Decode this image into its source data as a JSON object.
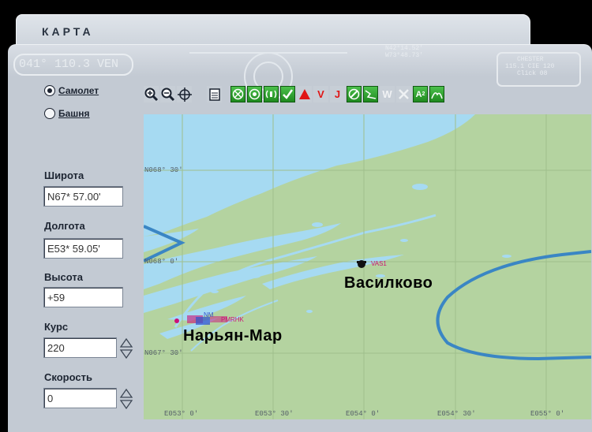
{
  "window": {
    "title": "КАРТА"
  },
  "background_text": {
    "left_freq": "041° 110.3 VEN",
    "right_box_1": "CHESTER",
    "right_box_2": "115.1 CIE 120",
    "right_box_3": "Click 08",
    "coords_1": "N42°14.52'",
    "coords_2": "W73°48.73'"
  },
  "mode": {
    "airplane_label": "Самолет",
    "tower_label": "Башня",
    "selected": "airplane"
  },
  "fields": {
    "latitude_label": "Широта",
    "latitude_value": "N67* 57.00'",
    "longitude_label": "Долгота",
    "longitude_value": "E53* 59.05'",
    "altitude_label": "Высота",
    "altitude_value": "+59",
    "heading_label": "Курс",
    "heading_value": "220",
    "speed_label": "Скорость",
    "speed_value": "0"
  },
  "toolbar": {
    "icons": [
      "zoom-in-icon",
      "zoom-out-icon",
      "center-icon",
      "print-icon",
      "vor-icon",
      "ndb-icon",
      "ils-icon",
      "check-icon",
      "triangle-icon",
      "v-icon",
      "j-icon",
      "airport-icon",
      "route-icon",
      "w-icon",
      "x-icon",
      "a-icon",
      "terrain-icon"
    ],
    "letters": {
      "v": "V",
      "j": "J",
      "w": "W",
      "a": "A"
    }
  },
  "map": {
    "cities": [
      {
        "name": "Василково",
        "code": "VAS1"
      },
      {
        "name": "Нарьян-Мар",
        "code": "NM"
      }
    ],
    "nm_label_extra": "PMRHK",
    "lat_labels": [
      "N068° 30'",
      "N068° 0'",
      "N067° 30'"
    ],
    "lon_labels": [
      "E053° 0'",
      "E053° 30'",
      "E054° 0'",
      "E054° 30'",
      "E055° 0'"
    ],
    "colors": {
      "land": "#b4d3a0",
      "water": "#a6daf2",
      "airspace": "#3a86c4"
    }
  }
}
